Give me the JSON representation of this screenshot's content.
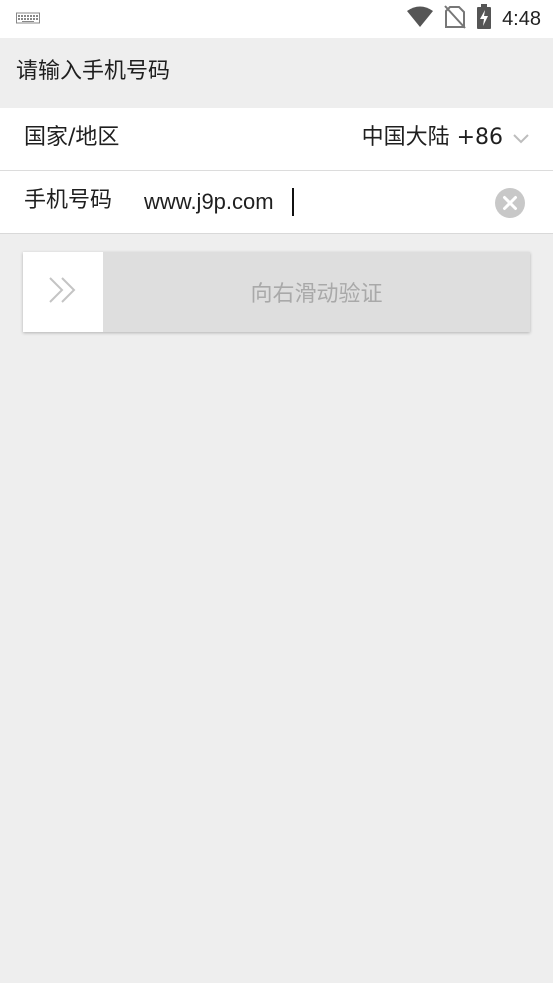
{
  "status_bar": {
    "time": "4:48",
    "icons": [
      "keyboard-icon",
      "wifi-icon",
      "no-sim-icon",
      "battery-charging-icon"
    ]
  },
  "header": {
    "title": "请输入手机号码"
  },
  "form": {
    "country_label": "国家/地区",
    "country_value": "中国大陆 +86",
    "phone_label": "手机号码",
    "phone_value": "www.j9p.com"
  },
  "slider": {
    "label": "向右滑动验证",
    "track_color": "#dedede",
    "handle_color": "#ffffff"
  }
}
